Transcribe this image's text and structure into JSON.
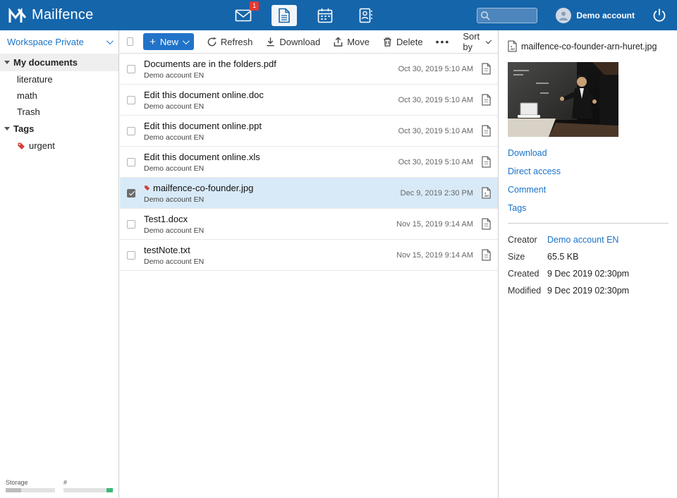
{
  "topbar": {
    "brand": "Mailfence",
    "mail_badge": "1",
    "search_placeholder": "",
    "account_name": "Demo account"
  },
  "sidebar": {
    "workspace_label": "Workspace Private",
    "my_documents_label": "My documents",
    "folders": [
      "literature",
      "math",
      "Trash"
    ],
    "tags_label": "Tags",
    "tags": [
      "urgent"
    ],
    "storage_label": "Storage",
    "count_label": "#"
  },
  "toolbar": {
    "plus": "+",
    "new_label": "New",
    "refresh_label": "Refresh",
    "download_label": "Download",
    "move_label": "Move",
    "delete_label": "Delete",
    "more_label": "•••",
    "sort_label": "Sort by"
  },
  "files": [
    {
      "name": "Documents are in the folders.pdf",
      "owner": "Demo account EN",
      "date": "Oct 30, 2019 5:10 AM"
    },
    {
      "name": "Edit this document online.doc",
      "owner": "Demo account EN",
      "date": "Oct 30, 2019 5:10 AM"
    },
    {
      "name": "Edit this document online.ppt",
      "owner": "Demo account EN",
      "date": "Oct 30, 2019 5:10 AM"
    },
    {
      "name": "Edit this document online.xls",
      "owner": "Demo account EN",
      "date": "Oct 30, 2019 5:10 AM"
    },
    {
      "name": "mailfence-co-founder.jpg",
      "owner": "Demo account EN",
      "date": "Dec 9, 2019 2:30 PM"
    },
    {
      "name": "Test1.docx",
      "owner": "Demo account EN",
      "date": "Nov 15, 2019 9:14 AM"
    },
    {
      "name": "testNote.txt",
      "owner": "Demo account EN",
      "date": "Nov 15, 2019 9:14 AM"
    }
  ],
  "details": {
    "filename": "mailfence-co-founder-arn-huret.jpg",
    "links": [
      "Download",
      "Direct access",
      "Comment",
      "Tags"
    ],
    "creator_label": "Creator",
    "creator_value": "Demo account EN",
    "size_label": "Size",
    "size_value": "65.5 KB",
    "created_label": "Created",
    "created_value": "9 Dec 2019 02:30pm",
    "modified_label": "Modified",
    "modified_value": "9 Dec 2019 02:30pm"
  }
}
